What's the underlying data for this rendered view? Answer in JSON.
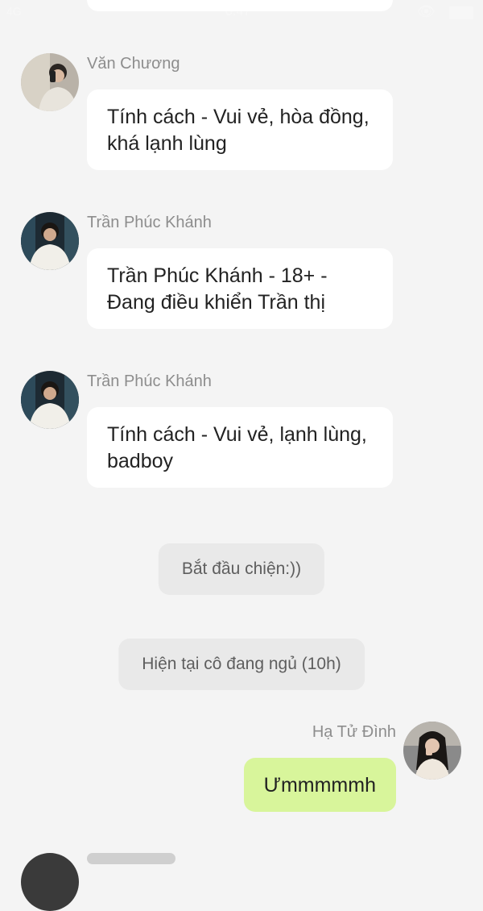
{
  "status_bar": {
    "signal": "4G",
    "time": "0:47"
  },
  "messages": [
    {
      "sender": "Văn Chương",
      "text": "Tính cách - Vui vẻ, hòa đồng, khá lạnh lùng"
    },
    {
      "sender": "Trần Phúc Khánh",
      "text": "Trần Phúc Khánh - 18+ - Đang điều khiển Trần thị"
    },
    {
      "sender": "Trần Phúc Khánh",
      "text": "Tính cách - Vui vẻ, lạnh lùng, badboy"
    }
  ],
  "system_messages": [
    "Bắt đầu chiện:))",
    "Hiện tại cô đang ngủ (10h)"
  ],
  "outgoing": {
    "sender": "Hạ Tử Đình",
    "text": "Ưmmmmmh",
    "bubble_color": "#d8f59b"
  },
  "colors": {
    "background": "#f4f4f4",
    "incoming_bubble": "#ffffff",
    "system_pill": "#e9e9e9",
    "name_text": "#8d8d8d"
  }
}
